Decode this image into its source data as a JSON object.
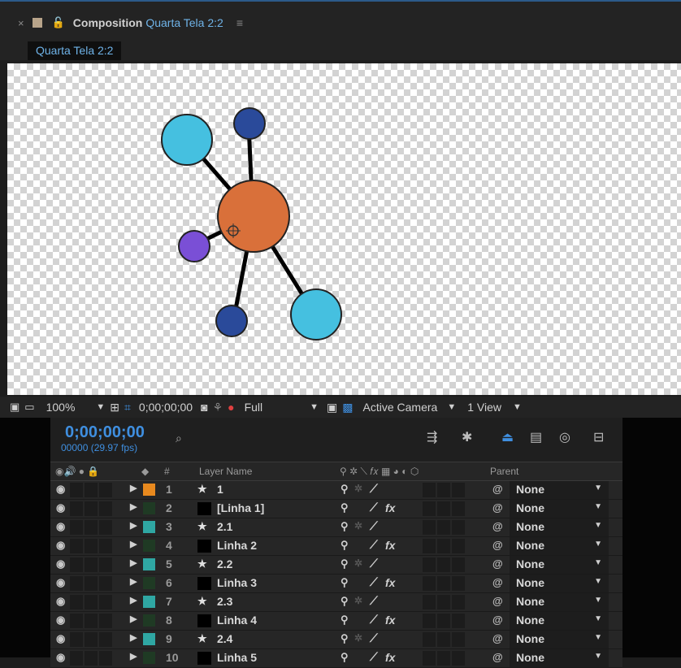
{
  "panel": {
    "close": "×",
    "lock": "🔓",
    "prefix": "Composition",
    "comp_name": "Quarta Tela 2:2",
    "menu": "≡",
    "tab_label": "Quarta Tela 2:2"
  },
  "viewer_bar": {
    "zoom": "100%",
    "timecode": "0;00;00;00",
    "resolution": "Full",
    "camera": "Active Camera",
    "views": "1 View"
  },
  "timeline": {
    "current_time": "0;00;00;00",
    "frames_fps": "00000 (29.97 fps)",
    "search_placeholder": "",
    "columns": {
      "number": "#",
      "layer_name": "Layer Name",
      "parent": "Parent"
    },
    "layers": [
      {
        "num": "1",
        "name": "1",
        "type": "star",
        "label_color": "#e8891e",
        "fx": false,
        "parent": "None"
      },
      {
        "num": "2",
        "name": "[Linha 1]",
        "type": "solid",
        "label_color": "#1f3a24",
        "fx": true,
        "parent": "None"
      },
      {
        "num": "3",
        "name": "2.1",
        "type": "star",
        "label_color": "#2fa7a3",
        "fx": false,
        "parent": "None"
      },
      {
        "num": "4",
        "name": "Linha 2",
        "type": "solid",
        "label_color": "#1f3a24",
        "fx": true,
        "parent": "None"
      },
      {
        "num": "5",
        "name": "2.2",
        "type": "star",
        "label_color": "#2fa7a3",
        "fx": false,
        "parent": "None"
      },
      {
        "num": "6",
        "name": "Linha 3",
        "type": "solid",
        "label_color": "#1f3a24",
        "fx": true,
        "parent": "None"
      },
      {
        "num": "7",
        "name": "2.3",
        "type": "star",
        "label_color": "#2fa7a3",
        "fx": false,
        "parent": "None"
      },
      {
        "num": "8",
        "name": "Linha 4",
        "type": "solid",
        "label_color": "#1f3a24",
        "fx": true,
        "parent": "None"
      },
      {
        "num": "9",
        "name": "2.4",
        "type": "star",
        "label_color": "#2fa7a3",
        "fx": false,
        "parent": "None"
      },
      {
        "num": "10",
        "name": "Linha 5",
        "type": "solid",
        "label_color": "#1f3a24",
        "fx": true,
        "parent": "None"
      }
    ]
  },
  "colors": {
    "accent": "#3f8fe0",
    "center_node": "#d9703a",
    "light_blue_node": "#45c0e0",
    "dark_blue_node": "#2a4a9a",
    "purple_node": "#7a4fd6"
  }
}
